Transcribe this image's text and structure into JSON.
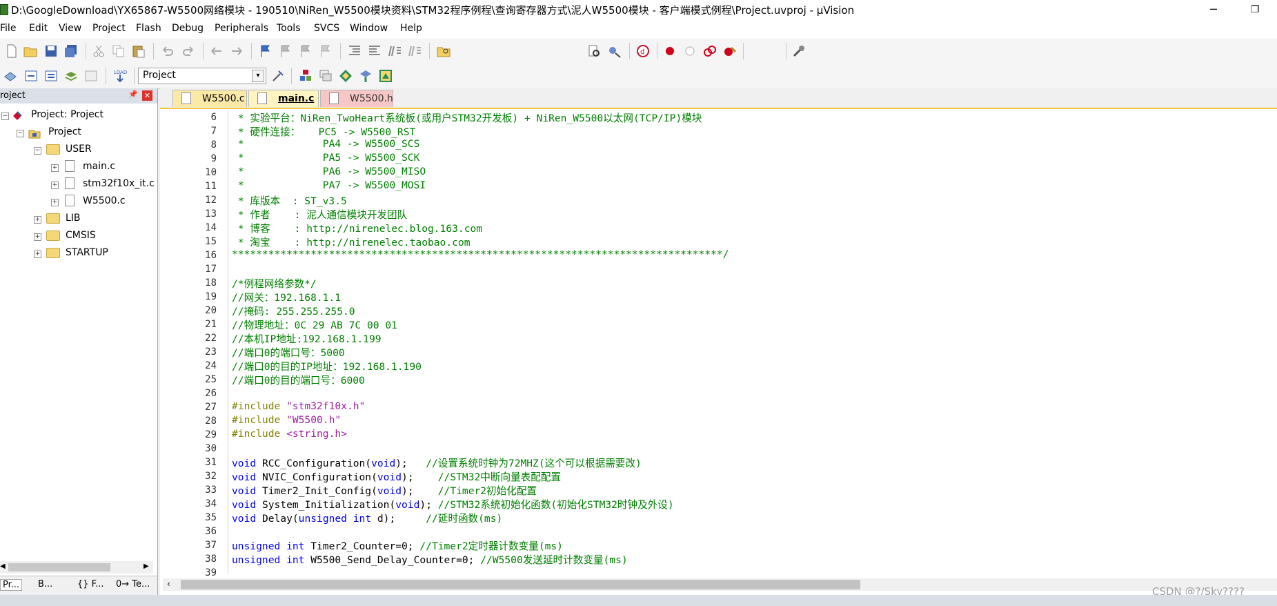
{
  "window": {
    "title": "D:\\GoogleDownload\\YX65867-W5500网络模块 - 190510\\NiRen_W5500模块资料\\STM32程序例程\\查询寄存器方式\\泥人W5500模块 - 客户端模式例程\\Project.uvproj - µVision",
    "minimize": "─",
    "restore": "❐"
  },
  "menu": [
    "File",
    "Edit",
    "View",
    "Project",
    "Flash",
    "Debug",
    "Peripherals",
    "Tools",
    "SVCS",
    "Window",
    "Help"
  ],
  "toolbar2": {
    "target_select": "Project"
  },
  "project_panel": {
    "header": "roject",
    "pin": "📌",
    "close": "✕",
    "tree": {
      "root": "Project: Project",
      "project": "Project",
      "user_folder": "USER",
      "files": [
        "main.c",
        "stm32f10x_it.c",
        "W5500.c"
      ],
      "lib": "LIB",
      "cmsis": "CMSIS",
      "startup": "STARTUP"
    },
    "bottom_tabs": [
      "Pr...",
      "B...",
      "{} F...",
      "0→ Te..."
    ]
  },
  "editor": {
    "tabs": [
      {
        "label": "W5500.c",
        "state": "inactive",
        "color": "#fbe9a8"
      },
      {
        "label": "main.c",
        "state": "active",
        "color": "#fff4c2"
      },
      {
        "label": "W5500.h",
        "state": "inactive",
        "color": "#f7c6c6"
      }
    ],
    "line_numbers": [
      6,
      7,
      8,
      9,
      10,
      11,
      12,
      13,
      14,
      15,
      16,
      17,
      18,
      19,
      20,
      21,
      22,
      23,
      24,
      25,
      26,
      27,
      28,
      29,
      30,
      31,
      32,
      33,
      34,
      35,
      36,
      37,
      38,
      39
    ],
    "lines": [
      [
        [
          "cm",
          " * 实验平台：NiRen_TwoHeart系统板(或用户STM32开发板) + NiRen_W5500以太网(TCP/IP)模块"
        ]
      ],
      [
        [
          "cm",
          " * 硬件连接：   PC5 -> W5500_RST"
        ]
      ],
      [
        [
          "cm",
          " *             PA4 -> W5500_SCS"
        ]
      ],
      [
        [
          "cm",
          " *             PA5 -> W5500_SCK"
        ]
      ],
      [
        [
          "cm",
          " *             PA6 -> W5500_MISO"
        ]
      ],
      [
        [
          "cm",
          " *             PA7 -> W5500_MOSI"
        ]
      ],
      [
        [
          "cm",
          " * 库版本  : ST_v3.5"
        ]
      ],
      [
        [
          "cm",
          " * 作者    : 泥人通信模块开发团队"
        ]
      ],
      [
        [
          "cm",
          " * 博客    : http://nirenelec.blog.163.com"
        ]
      ],
      [
        [
          "cm",
          " * 淘宝    : http://nirenelec.taobao.com"
        ]
      ],
      [
        [
          "cm",
          "*********************************************************************************/"
        ]
      ],
      [],
      [
        [
          "cm",
          "/*例程网络参数*/"
        ]
      ],
      [
        [
          "cm",
          "//网关：192.168.1.1"
        ]
      ],
      [
        [
          "cm",
          "//掩码: 255.255.255.0"
        ]
      ],
      [
        [
          "cm",
          "//物理地址：0C 29 AB 7C 00 01"
        ]
      ],
      [
        [
          "cm",
          "//本机IP地址:192.168.1.199"
        ]
      ],
      [
        [
          "cm",
          "//端口0的端口号：5000"
        ]
      ],
      [
        [
          "cm",
          "//端口0的目的IP地址：192.168.1.190"
        ]
      ],
      [
        [
          "cm",
          "//端口0的目的端口号：6000"
        ]
      ],
      [],
      [
        [
          "pp",
          "#include "
        ],
        [
          "str",
          "\"stm32f10x.h\""
        ]
      ],
      [
        [
          "pp",
          "#include "
        ],
        [
          "str",
          "\"W5500.h\""
        ]
      ],
      [
        [
          "pp",
          "#include "
        ],
        [
          "str",
          "<string.h>"
        ]
      ],
      [],
      [
        [
          "kw",
          "void"
        ],
        [
          "fn",
          " RCC_Configuration("
        ],
        [
          "kw",
          "void"
        ],
        [
          "fn",
          ");   "
        ],
        [
          "cm",
          "//设置系统时钟为72MHZ(这个可以根据需要改)"
        ]
      ],
      [
        [
          "kw",
          "void"
        ],
        [
          "fn",
          " NVIC_Configuration("
        ],
        [
          "kw",
          "void"
        ],
        [
          "fn",
          ");    "
        ],
        [
          "cm",
          "//STM32中断向量表配配置"
        ]
      ],
      [
        [
          "kw",
          "void"
        ],
        [
          "fn",
          " Timer2_Init_Config("
        ],
        [
          "kw",
          "void"
        ],
        [
          "fn",
          ");    "
        ],
        [
          "cm",
          "//Timer2初始化配置"
        ]
      ],
      [
        [
          "kw",
          "void"
        ],
        [
          "fn",
          " System_Initialization("
        ],
        [
          "kw",
          "void"
        ],
        [
          "fn",
          "); "
        ],
        [
          "cm",
          "//STM32系统初始化函数(初始化STM32时钟及外设)"
        ]
      ],
      [
        [
          "kw",
          "void"
        ],
        [
          "fn",
          " Delay("
        ],
        [
          "kw",
          "unsigned int"
        ],
        [
          "fn",
          " d);     "
        ],
        [
          "cm",
          "//延时函数(ms)"
        ]
      ],
      [],
      [
        [
          "kw",
          "unsigned int"
        ],
        [
          "fn",
          " Timer2_Counter=0; "
        ],
        [
          "cm",
          "//Timer2定时器计数变量(ms)"
        ]
      ],
      [
        [
          "kw",
          "unsigned int"
        ],
        [
          "fn",
          " W5500_Send_Delay_Counter=0; "
        ],
        [
          "cm",
          "//W5500发送延时计数变量(ms)"
        ]
      ],
      []
    ]
  },
  "watermark": "CSDN @?/Sky????"
}
